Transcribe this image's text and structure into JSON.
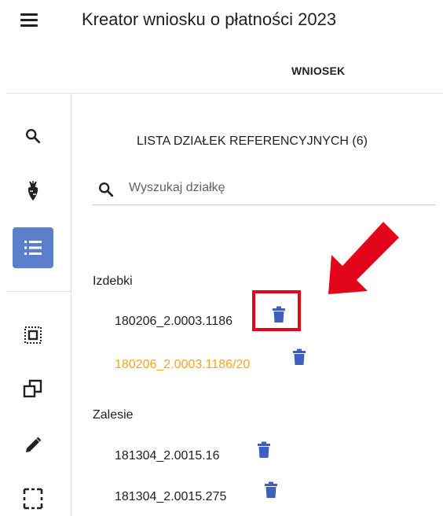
{
  "header": {
    "title": "Kreator wniosku o płatności 2023"
  },
  "tabs": [
    {
      "label": "WNIOSEK"
    }
  ],
  "sidebar": {
    "items": [
      {
        "icon": "search-icon"
      },
      {
        "icon": "crop-plant-icon"
      },
      {
        "icon": "list-icon",
        "active": true
      },
      {
        "icon": "select-area-icon"
      },
      {
        "icon": "copy-icon"
      },
      {
        "icon": "edit-pencil-icon"
      },
      {
        "icon": "selection-frame-icon"
      }
    ]
  },
  "list": {
    "title": "LISTA DZIAŁEK REFERENCYJNYCH (6)",
    "search_placeholder": "Wyszukaj działkę",
    "groups": [
      {
        "name": "Izdebki",
        "parcels": [
          {
            "label": "180206_2.0003.1186"
          },
          {
            "label": "180206_2.0003.1186/20",
            "highlight": true
          }
        ]
      },
      {
        "name": "Zalesie",
        "parcels": [
          {
            "label": "181304_2.0015.16"
          },
          {
            "label": "181304_2.0015.275"
          }
        ]
      }
    ]
  },
  "colors": {
    "accent": "#5c7fcc",
    "trash": "#3f5fbf",
    "highlight_text": "#f5a623",
    "annotation": "#e3061b"
  }
}
